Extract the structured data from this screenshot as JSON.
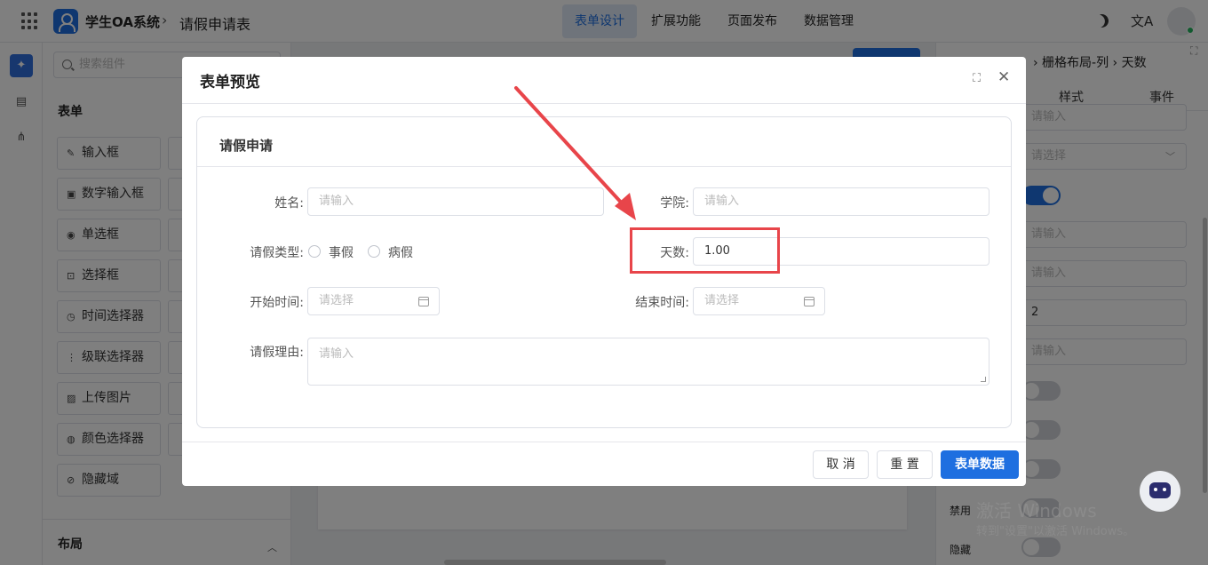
{
  "header": {
    "app_name": "学生OA系统",
    "crumb_sep": "›",
    "page_name": "请假申请表",
    "nav": [
      "表单设计",
      "扩展功能",
      "页面发布",
      "数据管理"
    ],
    "active_nav": 0,
    "translate_glyph": "文A"
  },
  "rail": {
    "icons": [
      "puzzle-icon",
      "form-icon",
      "tree-icon"
    ]
  },
  "components": {
    "search_placeholder": "搜索组件",
    "section_form": "表单",
    "items": [
      {
        "icon": "✎",
        "label": "输入框"
      },
      {
        "icon": "▣",
        "label": "数字输入框"
      },
      {
        "icon": "◉",
        "label": "单选框"
      },
      {
        "icon": "⊡",
        "label": "选择框"
      },
      {
        "icon": "◷",
        "label": "时间选择器"
      },
      {
        "icon": "⋮",
        "label": "级联选择器"
      },
      {
        "icon": "▨",
        "label": "上传图片"
      },
      {
        "icon": "◍",
        "label": "颜色选择器"
      },
      {
        "icon": "⊘",
        "label": "隐藏域"
      }
    ],
    "section_layout": "布局",
    "collapse_glyph": "︿"
  },
  "properties": {
    "breadcrumb": "› 栅格布局-列 › 天数",
    "tabs": [
      "样式",
      "事件"
    ],
    "fields": [
      {
        "value": "请输入",
        "filled": false
      },
      {
        "value": "请选择",
        "filled": false
      },
      {
        "value": "请输入",
        "filled": false
      },
      {
        "value": "请输入",
        "filled": false
      },
      {
        "value": "2",
        "filled": true
      },
      {
        "value": "请输入",
        "filled": false
      }
    ],
    "label_disabled": "禁用",
    "label_hidden": "隐藏",
    "watermark_line1": "激活 Windows",
    "watermark_line2": "转到\"设置\"以激活 Windows。"
  },
  "modal": {
    "title": "表单预览",
    "expand_glyph": "⛶",
    "close_glyph": "✕",
    "card_title": "请假申请",
    "fields": {
      "name": {
        "label": "姓名:",
        "placeholder": "请输入"
      },
      "college": {
        "label": "学院:",
        "placeholder": "请输入"
      },
      "leave_type": {
        "label": "请假类型:",
        "options": [
          "事假",
          "病假"
        ]
      },
      "days": {
        "label": "天数:",
        "value": "1.00"
      },
      "start": {
        "label": "开始时间:",
        "placeholder": "请选择"
      },
      "end": {
        "label": "结束时间:",
        "placeholder": "请选择"
      },
      "reason": {
        "label": "请假理由:",
        "placeholder": "请输入"
      }
    },
    "buttons": {
      "cancel": "取 消",
      "reset": "重 置",
      "submit": "表单数据"
    }
  },
  "colors": {
    "accent": "#1e6fe0",
    "annotation": "#e8454a"
  }
}
